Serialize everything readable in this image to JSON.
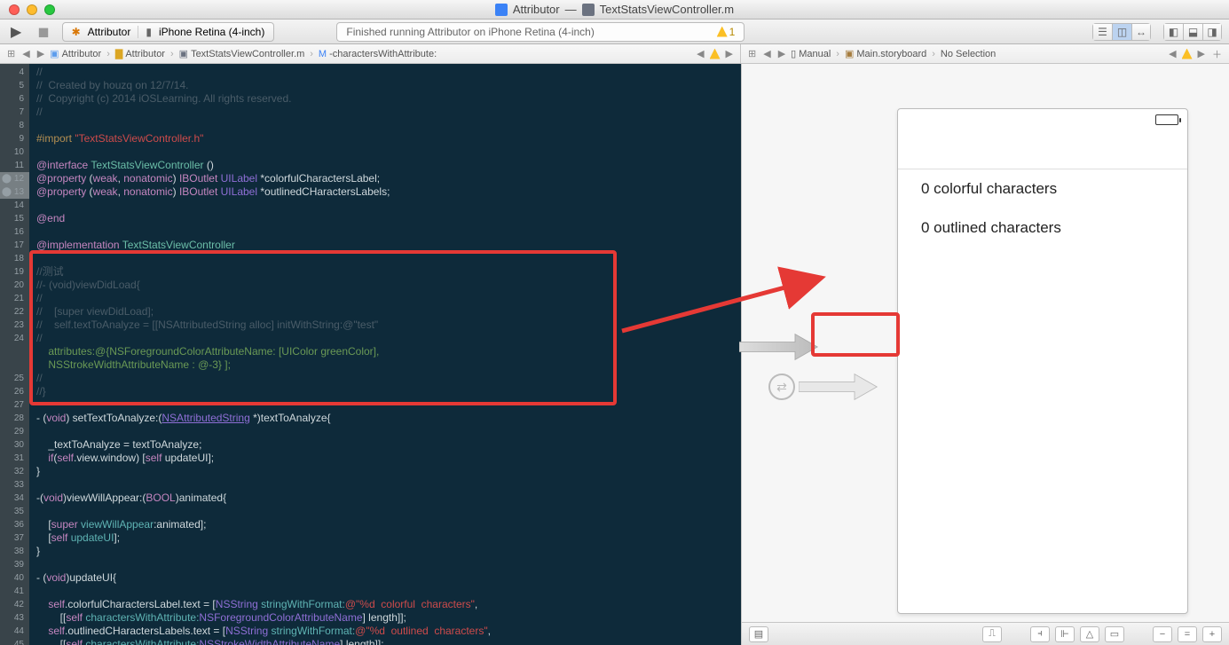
{
  "window": {
    "title_app": "Attributor",
    "title_sep": "—",
    "title_file": "TextStatsViewController.m"
  },
  "toolbar": {
    "scheme_name": "Attributor",
    "scheme_dest": "iPhone Retina (4-inch)",
    "activity": "Finished running Attributor on iPhone Retina (4-inch)",
    "warning_count": "1"
  },
  "jump_left": {
    "items": [
      "Attributor",
      "Attributor",
      "TextStatsViewController.m",
      "-charactersWithAttribute:"
    ]
  },
  "jump_right": {
    "mode": "Manual",
    "file": "Main.storyboard",
    "sel": "No Selection"
  },
  "code_lines": {
    "start": 4,
    "end": 45,
    "l4": "//",
    "l5": "//  Created by houzq on 12/7/14.",
    "l6": "//  Copyright (c) 2014 iOSLearning. All rights reserved.",
    "l7": "//",
    "l8": "",
    "l9a": "#import ",
    "l9b": "\"TextStatsViewController.h\"",
    "l10": "",
    "l11a": "@interface ",
    "l11b": "TextStatsViewController",
    "l11c": " ()",
    "l12a": "@property ",
    "l12b": "(",
    "l12c": "weak",
    "l12d": ", ",
    "l12e": "nonatomic",
    "l12f": ") ",
    "l12g": "IBOutlet ",
    "l12h": "UILabel",
    "l12i": " *colorfulCharactersLabel;",
    "l13a": "@property ",
    "l13b": "(",
    "l13c": "weak",
    "l13d": ", ",
    "l13e": "nonatomic",
    "l13f": ") ",
    "l13g": "IBOutlet ",
    "l13h": "UILabel",
    "l13i": " *outlinedCHaractersLabels;",
    "l14": "",
    "l15": "@end",
    "l16": "",
    "l17a": "@implementation ",
    "l17b": "TextStatsViewController",
    "l18": "",
    "l19": "//测试",
    "l20": "//- (void)viewDidLoad{",
    "l21": "//",
    "l22": "//    [super viewDidLoad];",
    "l23": "//    self.textToAnalyze = [[NSAttributedString alloc] initWithString:@\"test\"",
    "l24": "//",
    "l24b": "    attributes:@{NSForegroundColorAttributeName: [UIColor greenColor],",
    "l24c": "    NSStrokeWidthAttributeName : @-3} ];",
    "l25": "//",
    "l26": "//}",
    "l27": "",
    "l28a": "- (",
    "l28b": "void",
    "l28c": ") setTextToAnalyze:(",
    "l28d": "NSAttributedString",
    "l28e": " *)textToAnalyze{",
    "l29": "",
    "l30": "    _textToAnalyze = textToAnalyze;",
    "l31a": "    if",
    "l31b": "(",
    "l31c": "self",
    "l31d": ".view.window) [",
    "l31e": "self",
    "l31f": " updateUI];",
    "l32": "}",
    "l33": "",
    "l34a": "-(",
    "l34b": "void",
    "l34c": ")viewWillAppear:(",
    "l34d": "BOOL",
    "l34e": ")animated{",
    "l35": "",
    "l36a": "    [",
    "l36b": "super",
    "l36c": " viewWillAppear",
    "l36d": ":animated];",
    "l37a": "    [",
    "l37b": "self",
    "l37c": " updateUI",
    "l37d": "];",
    "l38": "}",
    "l39": "",
    "l40a": "- (",
    "l40b": "void",
    "l40c": ")updateUI{",
    "l41": "",
    "l42a": "    self",
    "l42b": ".colorfulCharactersLabel.text = [",
    "l42c": "NSString",
    "l42d": " stringWithFormat:",
    "l42e": "@\"%d  colorful  characters\"",
    "l42f": ",",
    "l43a": "        [[",
    "l43b": "self",
    "l43c": " charactersWithAttribute:",
    "l43d": "NSForegroundColorAttributeName",
    "l43e": "] length]];",
    "l44a": "    self",
    "l44b": ".outlinedCHaractersLabels.text = [",
    "l44c": "NSString",
    "l44d": " stringWithFormat:",
    "l44e": "@\"%d  outlined  characters\"",
    "l44f": ",",
    "l45a": "        [[",
    "l45b": "self",
    "l45c": " charactersWithAttribute:",
    "l45d": "NSStrokeWidthAttributeName",
    "l45e": "] length]];"
  },
  "ib": {
    "label1": "0 colorful characters",
    "label2": "0 outlined characters"
  }
}
